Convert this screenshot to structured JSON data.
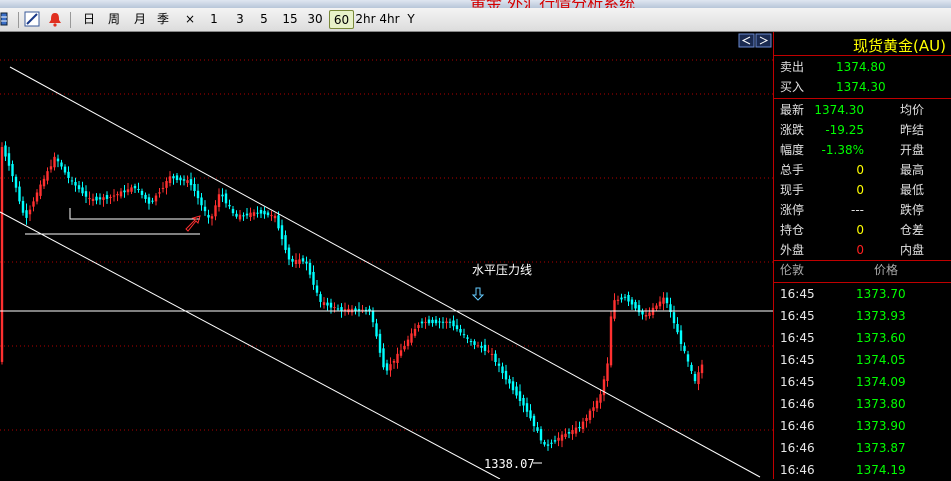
{
  "window": {
    "title": "黄金 外汇行情分析系统"
  },
  "toolbar": {
    "periods": [
      "日",
      "周",
      "月",
      "季",
      "×",
      "1",
      "3",
      "5",
      "15",
      "30",
      "60",
      "2hr",
      "4hr",
      "Y"
    ],
    "active_period": "60"
  },
  "chart": {
    "annotation": "水平压力线",
    "low_label": "1338.07"
  },
  "panel": {
    "title": "现货黄金(AU)",
    "sell": {
      "label": "卖出",
      "value": "1374.80"
    },
    "buy": {
      "label": "买入",
      "value": "1374.30"
    },
    "stats": [
      {
        "label": "最新",
        "value": "1374.30",
        "label2": "均价",
        "color": "green"
      },
      {
        "label": "涨跌",
        "value": "-19.25",
        "label2": "昨结",
        "color": "green"
      },
      {
        "label": "幅度",
        "value": "-1.38%",
        "label2": "开盘",
        "color": "green"
      },
      {
        "label": "总手",
        "value": "0",
        "label2": "最高",
        "color": "yellow"
      },
      {
        "label": "现手",
        "value": "0",
        "label2": "最低",
        "color": "yellow"
      },
      {
        "label": "涨停",
        "value": "---",
        "label2": "跌停",
        "color": "white"
      },
      {
        "label": "持仓",
        "value": "0",
        "label2": "仓差",
        "color": "yellow"
      },
      {
        "label": "外盘",
        "value": "0",
        "label2": "内盘",
        "color": "red"
      }
    ],
    "ticks_header": {
      "time": "伦敦",
      "price": "价格"
    },
    "ticks": [
      {
        "time": "16:45",
        "price": "1373.70"
      },
      {
        "time": "16:45",
        "price": "1373.93"
      },
      {
        "time": "16:45",
        "price": "1373.60"
      },
      {
        "time": "16:45",
        "price": "1374.05"
      },
      {
        "time": "16:45",
        "price": "1374.09"
      },
      {
        "time": "16:46",
        "price": "1373.80"
      },
      {
        "time": "16:46",
        "price": "1373.90"
      },
      {
        "time": "16:46",
        "price": "1373.87"
      },
      {
        "time": "16:46",
        "price": "1374.19"
      }
    ]
  },
  "colors": {
    "up": "#ff3030",
    "down": "#00ffff",
    "grid": "#b00000",
    "background": "#000000"
  }
}
